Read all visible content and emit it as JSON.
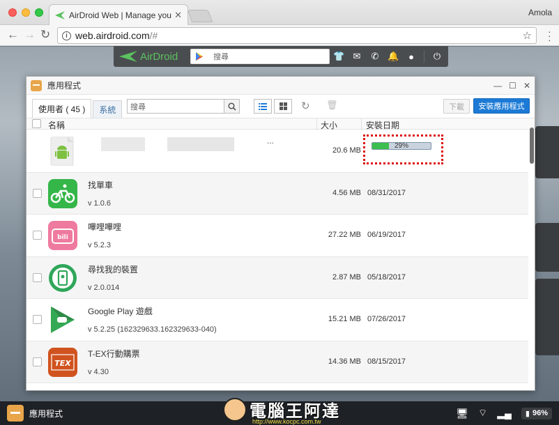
{
  "browser": {
    "tab_title": "AirDroid Web | Manage your ph",
    "profile": "Amola",
    "url_main": "web.airdroid.com",
    "url_rest": "/#"
  },
  "airdroid_bar": {
    "logo_text": "AirDroid",
    "search_placeholder": "搜尋"
  },
  "window": {
    "title": "應用程式",
    "tabs": [
      {
        "label": "使用者 ( 45 )"
      },
      {
        "label": "系統"
      }
    ],
    "search_placeholder": "搜尋",
    "download_label": "下載",
    "install_label": "安裝應用程式",
    "columns": {
      "name": "名稱",
      "size": "大小",
      "date": "安裝日期"
    }
  },
  "installing": {
    "ellipsis": "...",
    "size": "20.6 MB",
    "progress_text": "29%",
    "progress": 0.29
  },
  "apps": [
    {
      "name": "找單車",
      "version": "v 1.0.6",
      "size": "4.56 MB",
      "date": "08/31/2017"
    },
    {
      "name": "嗶哩嗶哩",
      "version": "v 5.2.3",
      "size": "27.22 MB",
      "date": "06/19/2017"
    },
    {
      "name": "尋找我的裝置",
      "version": "v 2.0.014",
      "size": "2.87 MB",
      "date": "05/18/2017"
    },
    {
      "name": "Google Play 遊戲",
      "version": "v 5.2.25 (162329633.162329633-040)",
      "size": "15.21 MB",
      "date": "07/26/2017"
    },
    {
      "name": "T-EX行動購票",
      "version": "v 4.30",
      "size": "14.36 MB",
      "date": "08/15/2017"
    }
  ],
  "taskbar": {
    "app_label": "應用程式",
    "watermark": "電腦王阿達",
    "watermark_url": "http://www.kocpc.com.tw",
    "battery": "96%"
  }
}
